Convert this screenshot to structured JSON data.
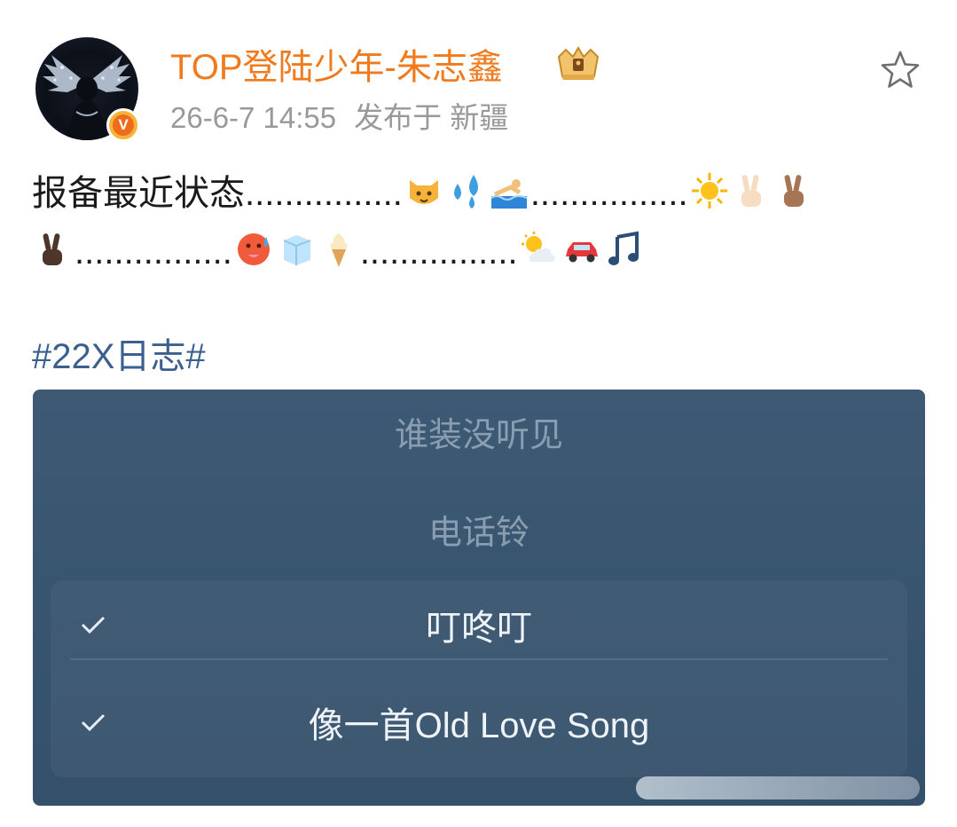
{
  "post": {
    "author_name": "TOP登陆少年-朱志鑫",
    "timestamp": "26-6-7 14:55",
    "location": "发布于 新疆",
    "verified_badge": "V",
    "favorite_icon": "star-outline-icon",
    "content_text": "报备最近状态",
    "dots": "................",
    "hashtag": "#22X日志#"
  },
  "emoji_line1": [
    "cat-emoji",
    "sweat-droplets-emoji",
    "swimmer-emoji",
    "sun-emoji",
    "victory-hand-light-emoji",
    "victory-hand-medium-emoji"
  ],
  "emoji_line2": [
    "victory-hand-dark-emoji",
    "hot-face-emoji",
    "ice-cube-emoji",
    "soft-ice-cream-emoji",
    "sun-behind-cloud-emoji",
    "red-car-emoji",
    "music-note-emoji"
  ],
  "picker": {
    "items": [
      {
        "label": "谁装没听见",
        "selected": false
      },
      {
        "label": "电话铃",
        "selected": false
      },
      {
        "label": "叮咚叮",
        "selected": true
      },
      {
        "label": "像一首Old Love Song",
        "selected": true
      }
    ]
  },
  "colors": {
    "username": "#f07a1c",
    "hashtag": "#3b5f8f",
    "meta": "#999999",
    "card_bg": "#395670"
  }
}
